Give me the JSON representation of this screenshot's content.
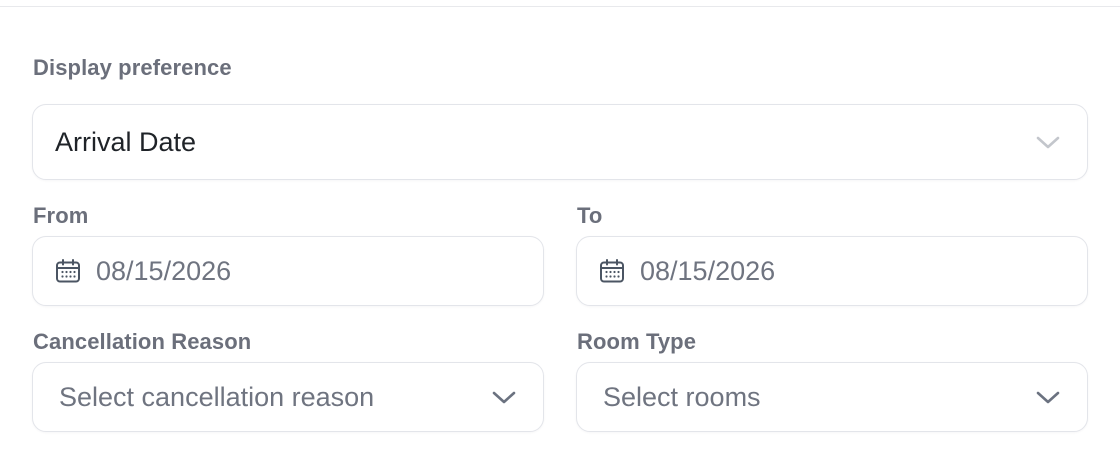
{
  "display_preference": {
    "label": "Display preference",
    "selected": "Arrival Date"
  },
  "from": {
    "label": "From",
    "value": "08/15/2026"
  },
  "to": {
    "label": "To",
    "value": "08/15/2026"
  },
  "cancellation_reason": {
    "label": "Cancellation Reason",
    "placeholder": "Select cancellation reason"
  },
  "room_type": {
    "label": "Room Type",
    "placeholder": "Select rooms"
  },
  "icons": {
    "chevron": "chevron-down-icon",
    "calendar": "calendar-icon"
  }
}
